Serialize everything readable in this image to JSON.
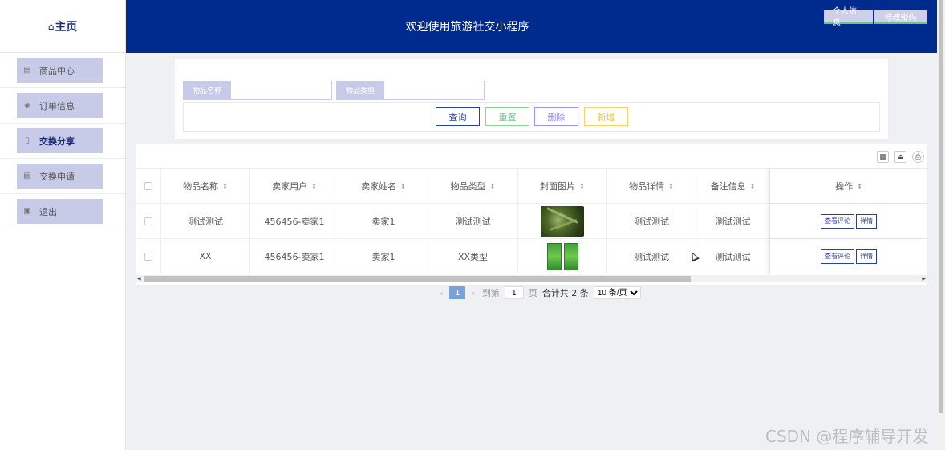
{
  "sidebar": {
    "home_label": "主页",
    "items": [
      {
        "label": "商品中心",
        "icon": "list-icon"
      },
      {
        "label": "订单信息",
        "icon": "layers-icon"
      },
      {
        "label": "交换分享",
        "icon": "share-icon",
        "active": true
      },
      {
        "label": "交换申请",
        "icon": "list-icon"
      },
      {
        "label": "退出",
        "icon": "clipboard-icon"
      }
    ]
  },
  "header": {
    "title": "欢迎使用旅游社交小程序",
    "profile_label": "个人信息",
    "change_password_label": "修改密码"
  },
  "search": {
    "name_label": "物品名称",
    "name_value": "",
    "type_label": "物品类型",
    "type_value": "",
    "query_label": "查询",
    "reset_label": "重置",
    "delete_label": "删除",
    "add_label": "新增"
  },
  "table": {
    "columns": [
      "物品名称",
      "卖家用户",
      "卖家姓名",
      "物品类型",
      "封面图片",
      "物品详情",
      "备注信息",
      "操作"
    ],
    "rows": [
      {
        "name": "测试测试",
        "seller_user": "456456-卖家1",
        "seller_name": "卖家1",
        "type": "测试测试",
        "image": "tea-leaves-image",
        "detail": "测试测试",
        "note": "测试测试"
      },
      {
        "name": "XX",
        "seller_user": "456456-卖家1",
        "seller_name": "卖家1",
        "type": "XX类型",
        "image": "tea-package-image",
        "detail": "测试测试",
        "note": "测试测试"
      }
    ],
    "view_comments_label": "查看评论",
    "detail_label": "详情"
  },
  "pagination": {
    "current_page": "1",
    "goto_label": "到第",
    "goto_value": "1",
    "page_label": "页",
    "total_label": "合计共 2 条",
    "page_size": "10 条/页"
  },
  "watermark": "CSDN @程序辅导开发"
}
